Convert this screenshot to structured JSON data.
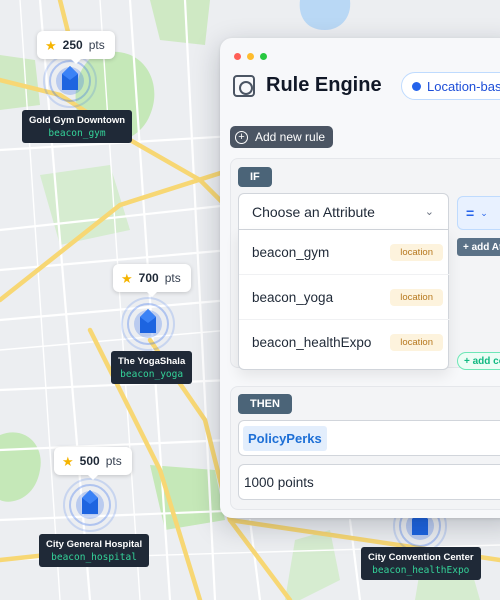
{
  "map": {
    "pins": [
      {
        "points_value": "250",
        "points_unit": "pts",
        "location": "Gold Gym Downtown",
        "beacon": "beacon_gym"
      },
      {
        "points_value": "700",
        "points_unit": "pts",
        "location": "The YogaShala",
        "beacon": "beacon_yoga"
      },
      {
        "points_value": "500",
        "points_unit": "pts",
        "location": "City General Hospital",
        "beacon": "beacon_hospital"
      },
      {
        "location": "City Convention Center",
        "beacon": "beacon_healthExpo"
      }
    ],
    "colors": {
      "water": "#b9d8f5",
      "park": "#c5e8b8",
      "road_major": "#fbe08a",
      "road_minor": "#ffffff",
      "beacon": "#2563eb"
    }
  },
  "panel": {
    "title": "Rule Engine",
    "location_pill": "Location-based",
    "add_rule_label": "Add new rule",
    "if_label": "IF",
    "attribute_placeholder": "Choose an Attribute",
    "attribute_options": [
      {
        "name": "beacon_gym",
        "tag": "location"
      },
      {
        "name": "beacon_yoga",
        "tag": "location"
      },
      {
        "name": "beacon_healthExpo",
        "tag": "location"
      }
    ],
    "operator": "=",
    "add_attribute_label": "+ add Attribute",
    "add_condition_label": "+ add condition",
    "then_label": "THEN",
    "policy_value": "PolicyPerks",
    "points_value": "1000 points"
  }
}
